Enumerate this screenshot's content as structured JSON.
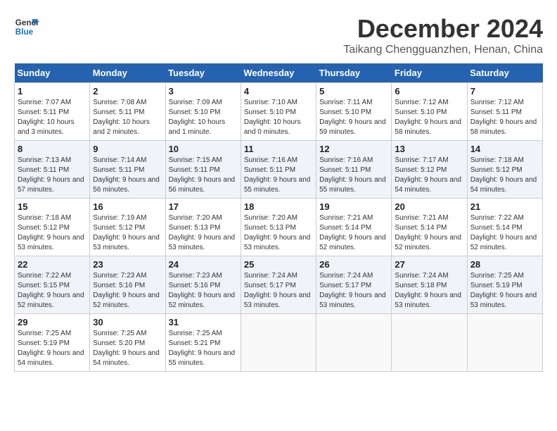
{
  "header": {
    "logo_line1": "General",
    "logo_line2": "Blue",
    "month": "December 2024",
    "location": "Taikang Chengguanzhen, Henan, China"
  },
  "weekdays": [
    "Sunday",
    "Monday",
    "Tuesday",
    "Wednesday",
    "Thursday",
    "Friday",
    "Saturday"
  ],
  "weeks": [
    [
      {
        "day": "1",
        "rise": "Sunrise: 7:07 AM",
        "set": "Sunset: 5:11 PM",
        "daylight": "Daylight: 10 hours and 3 minutes."
      },
      {
        "day": "2",
        "rise": "Sunrise: 7:08 AM",
        "set": "Sunset: 5:11 PM",
        "daylight": "Daylight: 10 hours and 2 minutes."
      },
      {
        "day": "3",
        "rise": "Sunrise: 7:09 AM",
        "set": "Sunset: 5:10 PM",
        "daylight": "Daylight: 10 hours and 1 minute."
      },
      {
        "day": "4",
        "rise": "Sunrise: 7:10 AM",
        "set": "Sunset: 5:10 PM",
        "daylight": "Daylight: 10 hours and 0 minutes."
      },
      {
        "day": "5",
        "rise": "Sunrise: 7:11 AM",
        "set": "Sunset: 5:10 PM",
        "daylight": "Daylight: 9 hours and 59 minutes."
      },
      {
        "day": "6",
        "rise": "Sunrise: 7:12 AM",
        "set": "Sunset: 5:10 PM",
        "daylight": "Daylight: 9 hours and 58 minutes."
      },
      {
        "day": "7",
        "rise": "Sunrise: 7:12 AM",
        "set": "Sunset: 5:11 PM",
        "daylight": "Daylight: 9 hours and 58 minutes."
      }
    ],
    [
      {
        "day": "8",
        "rise": "Sunrise: 7:13 AM",
        "set": "Sunset: 5:11 PM",
        "daylight": "Daylight: 9 hours and 57 minutes."
      },
      {
        "day": "9",
        "rise": "Sunrise: 7:14 AM",
        "set": "Sunset: 5:11 PM",
        "daylight": "Daylight: 9 hours and 56 minutes."
      },
      {
        "day": "10",
        "rise": "Sunrise: 7:15 AM",
        "set": "Sunset: 5:11 PM",
        "daylight": "Daylight: 9 hours and 56 minutes."
      },
      {
        "day": "11",
        "rise": "Sunrise: 7:16 AM",
        "set": "Sunset: 5:11 PM",
        "daylight": "Daylight: 9 hours and 55 minutes."
      },
      {
        "day": "12",
        "rise": "Sunrise: 7:16 AM",
        "set": "Sunset: 5:11 PM",
        "daylight": "Daylight: 9 hours and 55 minutes."
      },
      {
        "day": "13",
        "rise": "Sunrise: 7:17 AM",
        "set": "Sunset: 5:12 PM",
        "daylight": "Daylight: 9 hours and 54 minutes."
      },
      {
        "day": "14",
        "rise": "Sunrise: 7:18 AM",
        "set": "Sunset: 5:12 PM",
        "daylight": "Daylight: 9 hours and 54 minutes."
      }
    ],
    [
      {
        "day": "15",
        "rise": "Sunrise: 7:18 AM",
        "set": "Sunset: 5:12 PM",
        "daylight": "Daylight: 9 hours and 53 minutes."
      },
      {
        "day": "16",
        "rise": "Sunrise: 7:19 AM",
        "set": "Sunset: 5:12 PM",
        "daylight": "Daylight: 9 hours and 53 minutes."
      },
      {
        "day": "17",
        "rise": "Sunrise: 7:20 AM",
        "set": "Sunset: 5:13 PM",
        "daylight": "Daylight: 9 hours and 53 minutes."
      },
      {
        "day": "18",
        "rise": "Sunrise: 7:20 AM",
        "set": "Sunset: 5:13 PM",
        "daylight": "Daylight: 9 hours and 53 minutes."
      },
      {
        "day": "19",
        "rise": "Sunrise: 7:21 AM",
        "set": "Sunset: 5:14 PM",
        "daylight": "Daylight: 9 hours and 52 minutes."
      },
      {
        "day": "20",
        "rise": "Sunrise: 7:21 AM",
        "set": "Sunset: 5:14 PM",
        "daylight": "Daylight: 9 hours and 52 minutes."
      },
      {
        "day": "21",
        "rise": "Sunrise: 7:22 AM",
        "set": "Sunset: 5:14 PM",
        "daylight": "Daylight: 9 hours and 52 minutes."
      }
    ],
    [
      {
        "day": "22",
        "rise": "Sunrise: 7:22 AM",
        "set": "Sunset: 5:15 PM",
        "daylight": "Daylight: 9 hours and 52 minutes."
      },
      {
        "day": "23",
        "rise": "Sunrise: 7:23 AM",
        "set": "Sunset: 5:16 PM",
        "daylight": "Daylight: 9 hours and 52 minutes."
      },
      {
        "day": "24",
        "rise": "Sunrise: 7:23 AM",
        "set": "Sunset: 5:16 PM",
        "daylight": "Daylight: 9 hours and 52 minutes."
      },
      {
        "day": "25",
        "rise": "Sunrise: 7:24 AM",
        "set": "Sunset: 5:17 PM",
        "daylight": "Daylight: 9 hours and 53 minutes."
      },
      {
        "day": "26",
        "rise": "Sunrise: 7:24 AM",
        "set": "Sunset: 5:17 PM",
        "daylight": "Daylight: 9 hours and 53 minutes."
      },
      {
        "day": "27",
        "rise": "Sunrise: 7:24 AM",
        "set": "Sunset: 5:18 PM",
        "daylight": "Daylight: 9 hours and 53 minutes."
      },
      {
        "day": "28",
        "rise": "Sunrise: 7:25 AM",
        "set": "Sunset: 5:19 PM",
        "daylight": "Daylight: 9 hours and 53 minutes."
      }
    ],
    [
      {
        "day": "29",
        "rise": "Sunrise: 7:25 AM",
        "set": "Sunset: 5:19 PM",
        "daylight": "Daylight: 9 hours and 54 minutes."
      },
      {
        "day": "30",
        "rise": "Sunrise: 7:25 AM",
        "set": "Sunset: 5:20 PM",
        "daylight": "Daylight: 9 hours and 54 minutes."
      },
      {
        "day": "31",
        "rise": "Sunrise: 7:25 AM",
        "set": "Sunset: 5:21 PM",
        "daylight": "Daylight: 9 hours and 55 minutes."
      },
      null,
      null,
      null,
      null
    ]
  ]
}
